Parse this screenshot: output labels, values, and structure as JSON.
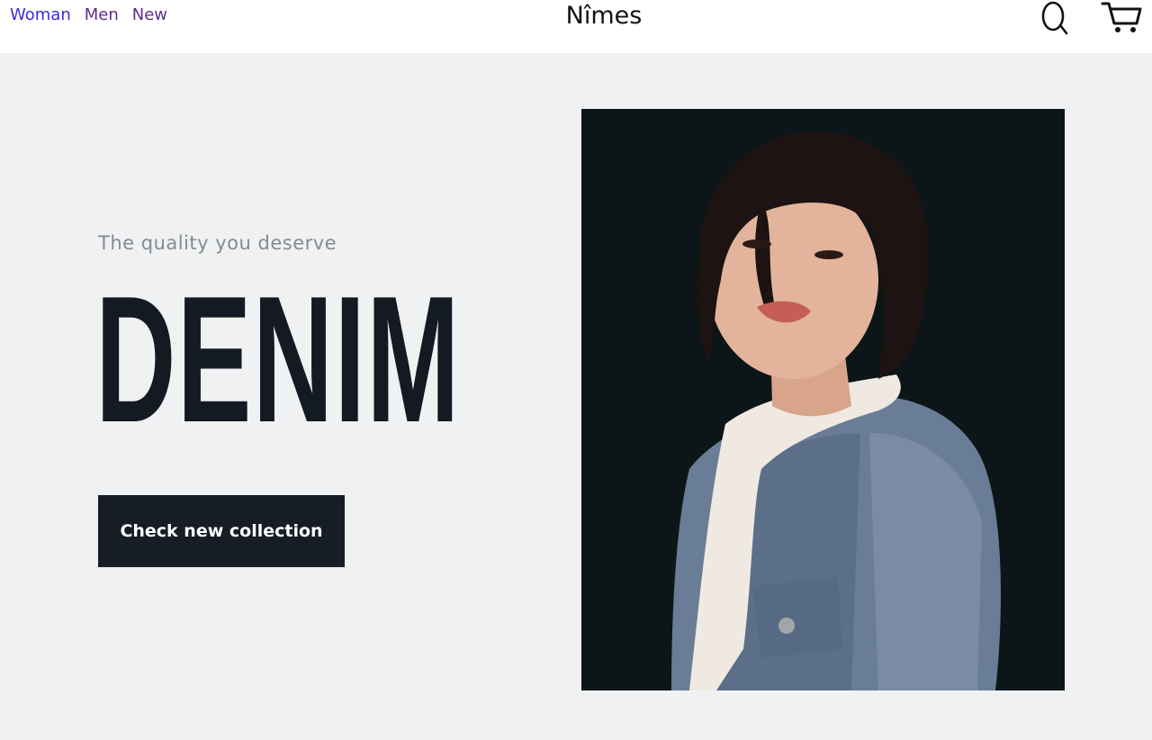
{
  "header": {
    "nav": [
      {
        "label": "Woman"
      },
      {
        "label": "Men"
      },
      {
        "label": "New"
      }
    ],
    "brand": "Nîmes",
    "icons": {
      "search": "search-icon",
      "cart": "cart-icon"
    }
  },
  "hero": {
    "subtitle": "The quality you deserve",
    "title": "DENIM",
    "cta_label": "Check new collection",
    "image_alt": "Woman with dark bob haircut wearing a sherpa-lined denim jacket"
  },
  "colors": {
    "background": "#f0f1f3",
    "header": "#ffffff",
    "ink": "#131a22",
    "button": "#161d24",
    "link_active": "#3b2bd6",
    "link_visited": "#5a2c91"
  }
}
